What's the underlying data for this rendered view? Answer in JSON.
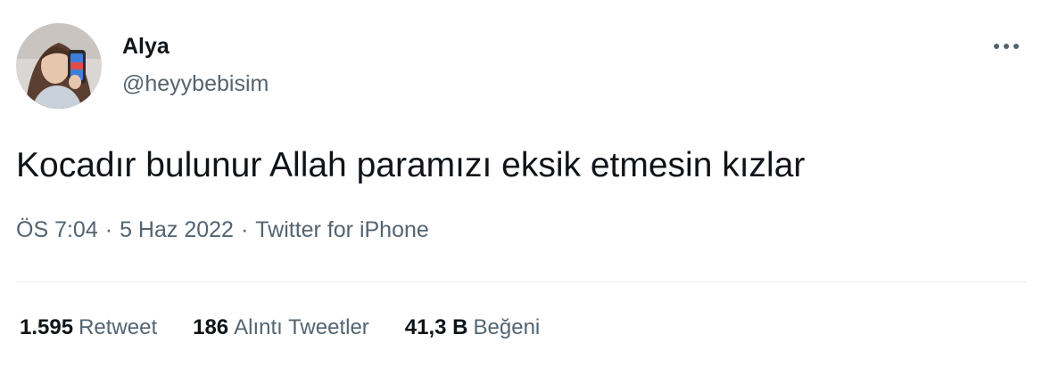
{
  "author": {
    "display_name": "Alya",
    "handle": "@heyybebisim"
  },
  "tweet": {
    "text": "Kocadır bulunur Allah paramızı eksik etmesin kızlar",
    "time": "ÖS 7:04",
    "separator": "·",
    "date": "5 Haz 2022",
    "source": "Twitter for iPhone"
  },
  "stats": {
    "retweets": {
      "value": "1.595",
      "label": "Retweet"
    },
    "quotes": {
      "value": "186",
      "label": "Alıntı Tweetler"
    },
    "likes": {
      "value": "41,3 B",
      "label": "Beğeni"
    }
  },
  "icons": {
    "more": "more-horizontal-icon"
  },
  "colors": {
    "text_primary": "#0f1419",
    "text_secondary": "#536471",
    "divider": "#e6ecf0",
    "background": "#ffffff"
  }
}
